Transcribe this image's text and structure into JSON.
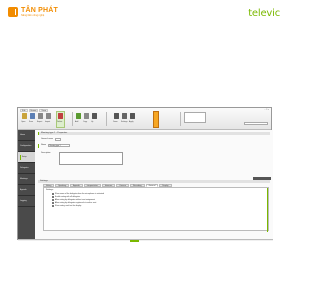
{
  "branding": {
    "left_name": "TÂN PHÁT",
    "left_tagline": "Nâng tầm công nghệ",
    "right_name": "televic"
  },
  "colors": {
    "accent": "#7ab800",
    "orange": "#f28c00",
    "sidebar": "#4a4a4a",
    "highlight": "#f6a623"
  },
  "app": {
    "ribbon_tabs": [
      "File",
      "Home",
      "View"
    ],
    "toolbar_buttons": [
      {
        "label": "Open",
        "icon": "folder-icon",
        "color": "#c9a33b"
      },
      {
        "label": "Save",
        "icon": "save-icon",
        "color": "#5b7fb5"
      },
      {
        "label": "Export",
        "icon": "export-icon",
        "color": "#888888"
      },
      {
        "label": "Import",
        "icon": "import-icon",
        "color": "#888888"
      },
      {
        "label": "Delete",
        "icon": "delete-icon",
        "color": "#c04040"
      },
      {
        "label": "Add",
        "icon": "add-icon",
        "color": "#5a9a30"
      },
      {
        "label": "Copy",
        "icon": "copy-icon",
        "color": "#888888"
      },
      {
        "label": "Up",
        "icon": "arrow-up-icon",
        "color": "#555555"
      },
      {
        "label": "Down",
        "icon": "arrow-down-icon",
        "color": "#555555"
      },
      {
        "label": "Settings",
        "icon": "gear-icon",
        "color": "#666666"
      },
      {
        "label": "Apply",
        "icon": "apply-icon",
        "color": "#555555"
      }
    ],
    "panel_rows": [
      "",
      "",
      ""
    ],
    "top_right_field": "",
    "window_controls": "– □ ×"
  },
  "sidebar": {
    "items": [
      {
        "label": "Home"
      },
      {
        "label": "Configuration"
      },
      {
        "label": "Setup",
        "active": true
      },
      {
        "label": "Delegates"
      },
      {
        "label": "Meetings"
      },
      {
        "label": "Agenda"
      },
      {
        "label": "Logging"
      }
    ]
  },
  "main": {
    "section_title": "Meeting type 1 - Properties",
    "fields": [
      {
        "label": "General name",
        "value": ""
      },
      {
        "label": "Name",
        "value": "Meeting type 1"
      }
    ],
    "description_label": "Description",
    "sub_section_title": "Settings",
    "dark_field_label": "",
    "tabs": [
      {
        "label": "Voting",
        "active": false
      },
      {
        "label": "Speaking",
        "active": false
      },
      {
        "label": "Agenda",
        "active": false
      },
      {
        "label": "Interpretation",
        "active": false
      },
      {
        "label": "Intercom",
        "active": false
      },
      {
        "label": "Camera",
        "active": false
      },
      {
        "label": "Recording",
        "active": false
      },
      {
        "label": "General",
        "active": true
      },
      {
        "label": "Display",
        "active": false
      }
    ],
    "tab_heading": "Settings",
    "options": [
      "Show name of the delegate when the microphone is activated",
      "Enable voting with all delegates",
      "Allow voting by delegates without seat assignment",
      "Allow voting by delegates registered at another seat",
      "Show voting result on the display"
    ]
  },
  "status": {
    "left": "",
    "right": ""
  }
}
